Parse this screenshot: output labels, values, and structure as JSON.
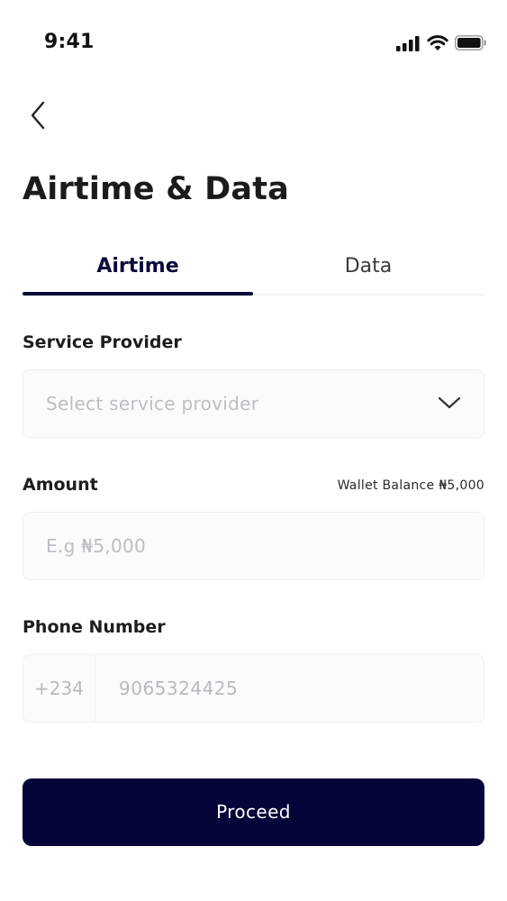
{
  "status_bar": {
    "time": "9:41",
    "icons": [
      "signal-icon",
      "wifi-icon",
      "battery-icon"
    ]
  },
  "header": {
    "back_icon": "chevron-left-icon",
    "title": "Airtime & Data"
  },
  "tabs": [
    {
      "label": "Airtime",
      "active": true
    },
    {
      "label": "Data",
      "active": false
    }
  ],
  "form": {
    "service_provider": {
      "label": "Service Provider",
      "placeholder": "Select service provider",
      "icon": "chevron-down-icon"
    },
    "amount": {
      "label": "Amount",
      "wallet_balance": "Wallet Balance ₦5,000",
      "placeholder": "E.g ₦5,000"
    },
    "phone_number": {
      "label": "Phone Number",
      "country_code": "+234",
      "placeholder": "9065324425"
    }
  },
  "actions": {
    "proceed_label": "Proceed"
  },
  "colors": {
    "primary": "#05053a",
    "field_bg": "#fbfbfd",
    "placeholder": "#bdbdc6"
  }
}
